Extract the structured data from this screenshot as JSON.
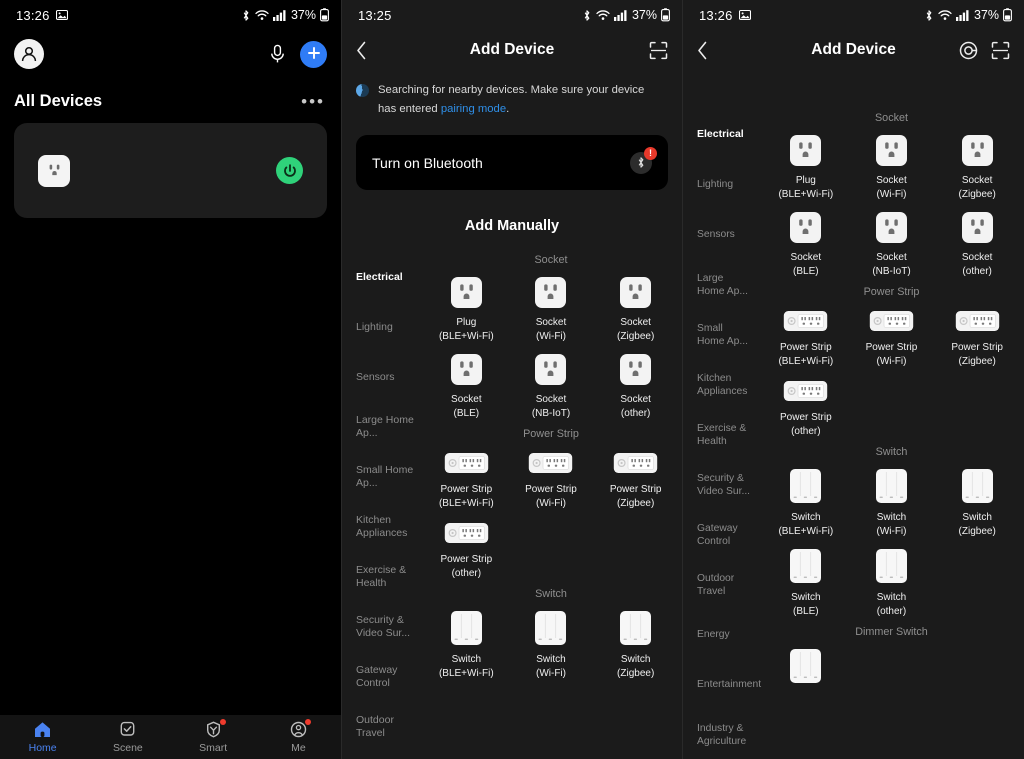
{
  "statusbar": {
    "time_1": "13:26",
    "time_2": "13:25",
    "time_3": "13:26",
    "battery": "37%",
    "icons": [
      "image-icon",
      "bluetooth-icon",
      "wifi-icon",
      "cellular-signal-icon",
      "battery-icon"
    ]
  },
  "panel1": {
    "header": {
      "avatar": "profile-avatar",
      "mic": "microphone-icon",
      "add": "plus-icon"
    },
    "section_title": "All Devices",
    "more_label": "•••",
    "device": {
      "icon": "socket-icon",
      "power_state_color": "#2fd27a",
      "power_icon": "power-icon"
    },
    "tabs": [
      {
        "label": "Home",
        "icon": "home-icon",
        "active": true,
        "badge": false
      },
      {
        "label": "Scene",
        "icon": "scene-check-icon",
        "active": false,
        "badge": false
      },
      {
        "label": "Smart",
        "icon": "smart-automation-icon",
        "active": false,
        "badge": true
      },
      {
        "label": "Me",
        "icon": "profile-icon",
        "active": false,
        "badge": true
      }
    ]
  },
  "panel2": {
    "title": "Add Device",
    "back_icon": "back-chevron-icon",
    "scan_icon": "scan-frame-icon",
    "searching": {
      "text_before": "Searching for nearby devices. Make sure your device has entered ",
      "link": "pairing mode",
      "text_after": "."
    },
    "bluetooth_banner": {
      "label": "Turn on Bluetooth",
      "icon": "bluetooth-icon",
      "badge": "!"
    },
    "add_manually": "Add Manually",
    "categories": [
      "Electrical",
      "Lighting",
      "Sensors",
      "Large Home Ap...",
      "Small Home Ap...",
      "Kitchen Appliances",
      "Exercise & Health",
      "Security & Video Sur...",
      "Gateway Control",
      "Outdoor Travel"
    ],
    "active_category": "Electrical",
    "groups": [
      {
        "name": "Socket",
        "items": [
          {
            "name": "Plug",
            "variant": "(BLE+Wi-Fi)",
            "art": "socket-art"
          },
          {
            "name": "Socket",
            "variant": "(Wi-Fi)",
            "art": "socket-art"
          },
          {
            "name": "Socket",
            "variant": "(Zigbee)",
            "art": "socket-art"
          },
          {
            "name": "Socket",
            "variant": "(BLE)",
            "art": "socket-art"
          },
          {
            "name": "Socket",
            "variant": "(NB-IoT)",
            "art": "socket-art"
          },
          {
            "name": "Socket",
            "variant": "(other)",
            "art": "socket-art"
          }
        ]
      },
      {
        "name": "Power Strip",
        "items": [
          {
            "name": "Power Strip",
            "variant": "(BLE+Wi-Fi)",
            "art": "power-strip-art"
          },
          {
            "name": "Power Strip",
            "variant": "(Wi-Fi)",
            "art": "power-strip-art"
          },
          {
            "name": "Power Strip",
            "variant": "(Zigbee)",
            "art": "power-strip-art"
          },
          {
            "name": "Power Strip",
            "variant": "(other)",
            "art": "power-strip-art"
          }
        ]
      },
      {
        "name": "Switch",
        "items": [
          {
            "name": "Switch",
            "variant": "(BLE+Wi-Fi)",
            "art": "switch-art"
          },
          {
            "name": "Switch",
            "variant": "(Wi-Fi)",
            "art": "switch-art"
          },
          {
            "name": "Switch",
            "variant": "(Zigbee)",
            "art": "switch-art"
          }
        ]
      }
    ]
  },
  "panel3": {
    "title": "Add Device",
    "back_icon": "back-chevron-icon",
    "target_icon": "target-locate-icon",
    "scan_icon": "scan-frame-icon",
    "categories": [
      "Electrical",
      "Lighting",
      "Sensors",
      "Large Home Ap...",
      "Small Home Ap...",
      "Kitchen Appliances",
      "Exercise & Health",
      "Security & Video Sur...",
      "Gateway Control",
      "Outdoor Travel",
      "Energy",
      "Entertainment",
      "Industry & Agriculture"
    ],
    "active_category": "Electrical",
    "groups": [
      {
        "name": "Socket",
        "items": [
          {
            "name": "Plug",
            "variant": "(BLE+Wi-Fi)",
            "art": "socket-art"
          },
          {
            "name": "Socket",
            "variant": "(Wi-Fi)",
            "art": "socket-art"
          },
          {
            "name": "Socket",
            "variant": "(Zigbee)",
            "art": "socket-art"
          },
          {
            "name": "Socket",
            "variant": "(BLE)",
            "art": "socket-art"
          },
          {
            "name": "Socket",
            "variant": "(NB-IoT)",
            "art": "socket-art"
          },
          {
            "name": "Socket",
            "variant": "(other)",
            "art": "socket-art"
          }
        ]
      },
      {
        "name": "Power Strip",
        "items": [
          {
            "name": "Power Strip",
            "variant": "(BLE+Wi-Fi)",
            "art": "power-strip-art"
          },
          {
            "name": "Power Strip",
            "variant": "(Wi-Fi)",
            "art": "power-strip-art"
          },
          {
            "name": "Power Strip",
            "variant": "(Zigbee)",
            "art": "power-strip-art"
          },
          {
            "name": "Power Strip",
            "variant": "(other)",
            "art": "power-strip-art"
          }
        ]
      },
      {
        "name": "Switch",
        "items": [
          {
            "name": "Switch",
            "variant": "(BLE+Wi-Fi)",
            "art": "switch-art"
          },
          {
            "name": "Switch",
            "variant": "(Wi-Fi)",
            "art": "switch-art"
          },
          {
            "name": "Switch",
            "variant": "(Zigbee)",
            "art": "switch-art"
          },
          {
            "name": "Switch",
            "variant": "(BLE)",
            "art": "switch-art"
          },
          {
            "name": "Switch",
            "variant": "(other)",
            "art": "switch-art"
          }
        ]
      },
      {
        "name": "Dimmer Switch",
        "items": [
          {
            "name": "",
            "variant": "",
            "art": "switch-art"
          }
        ]
      }
    ]
  },
  "colors": {
    "accent_blue": "#2f7cf6",
    "tab_active": "#4a82f0",
    "power_green": "#2fd27a",
    "badge_red": "#e8392b",
    "link_blue": "#2f8fe8"
  }
}
